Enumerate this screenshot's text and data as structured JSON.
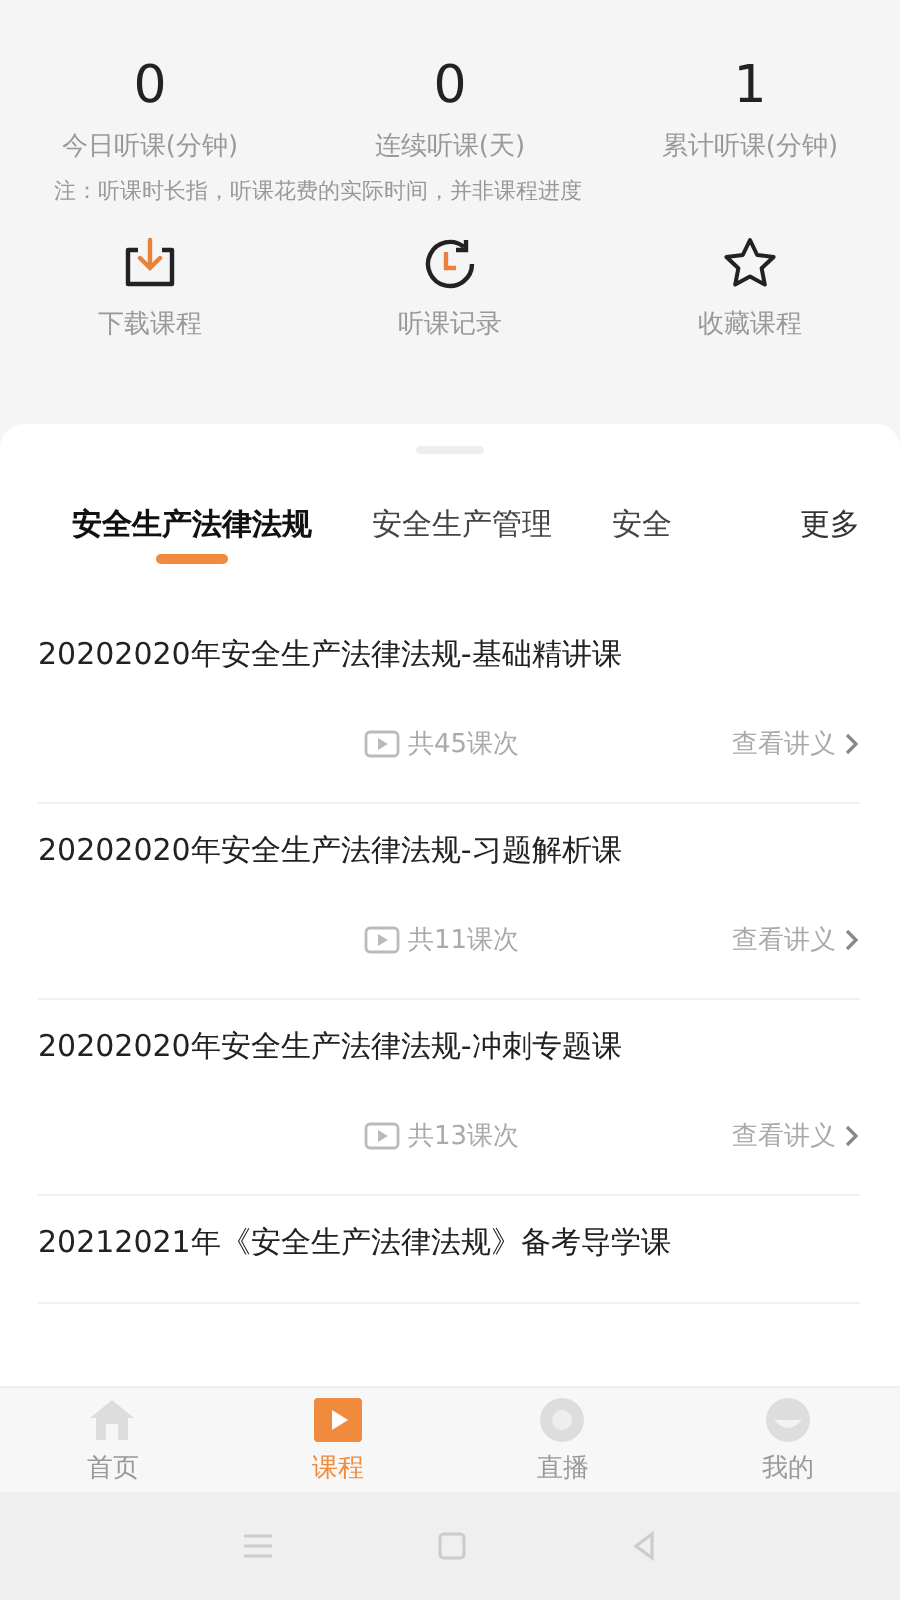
{
  "stats": [
    {
      "value": "0",
      "label": "今日听课(分钟)"
    },
    {
      "value": "0",
      "label": "连续听课(天)"
    },
    {
      "value": "1",
      "label": "累计听课(分钟)"
    }
  ],
  "note": "注：听课时长指，听课花费的实际时间，并非课程进度",
  "shortcuts": [
    {
      "kind": "download",
      "label": "下载课程"
    },
    {
      "kind": "history",
      "label": "听课记录"
    },
    {
      "kind": "favorite",
      "label": "收藏课程"
    }
  ],
  "category_tabs": [
    {
      "label": "安全生产法律法规",
      "selected": true
    },
    {
      "label": "安全生产管理",
      "selected": false
    },
    {
      "label": "安全",
      "selected": false
    }
  ],
  "more": "更多",
  "courses": [
    {
      "title": "20202020年安全生产法律法规-基础精讲课",
      "lessons": "共45课次",
      "handout": "查看讲义"
    },
    {
      "title": "20202020年安全生产法律法规-习题解析课",
      "lessons": "共11课次",
      "handout": "查看讲义"
    },
    {
      "title": "20202020年安全生产法律法规-冲刺专题课",
      "lessons": "共13课次",
      "handout": "查看讲义"
    },
    {
      "title": "20212021年《安全生产法律法规》备考导学课"
    }
  ],
  "bottom_tabs": [
    {
      "kind": "home",
      "label": "首页",
      "selected": false
    },
    {
      "kind": "course",
      "label": "课程",
      "selected": true
    },
    {
      "kind": "live",
      "label": "直播",
      "selected": false
    },
    {
      "kind": "me",
      "label": "我的",
      "selected": false
    }
  ]
}
